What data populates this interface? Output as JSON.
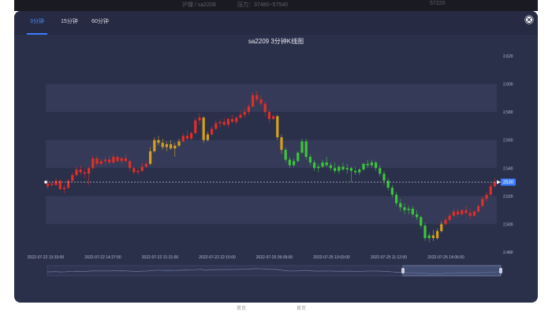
{
  "backdrop": {
    "top_items": [
      "沪镍 / sa2208",
      "压力：37480~57540",
      "57220"
    ],
    "bottom_items": [
      "首页",
      "首页"
    ]
  },
  "tabs": [
    {
      "label": "3分钟",
      "active": true
    },
    {
      "label": "15分钟",
      "active": false
    },
    {
      "label": "60分钟",
      "active": false
    }
  ],
  "close_icon": "close-circle-icon",
  "colors": {
    "background": "#2a2f4a",
    "band": "#343a57",
    "up": "#e02e28",
    "down": "#3ec43c",
    "flat": "#d4a020",
    "accent": "#3b7bff"
  },
  "chart_data": {
    "type": "candlestick",
    "title": "sa2209 3分钟K线图",
    "ylim": [
      2480,
      2620
    ],
    "yticks": [
      "2,620",
      "2,600",
      "2,580",
      "2,560",
      "2,540",
      "2,520",
      "2,500",
      "2,480"
    ],
    "xticks": [
      "2022-07-22 13:33:00",
      "2022-07-22 14:27:00",
      "2022-07-22 21:21:00",
      "2022-07-22 22:15:00",
      "2022-07-25 09:09:00",
      "2022-07-25 10:03:00",
      "2022-07-25 11:12:00",
      "2022-07-25 14:06:00"
    ],
    "current_price": 2530,
    "current_label": "2530",
    "grid": true,
    "bars": [
      {
        "o": 2527,
        "h": 2532,
        "l": 2525,
        "c": 2529,
        "color": "up"
      },
      {
        "o": 2529,
        "h": 2531,
        "l": 2527,
        "c": 2528,
        "color": "up"
      },
      {
        "o": 2528,
        "h": 2533,
        "l": 2527,
        "c": 2531,
        "color": "up"
      },
      {
        "o": 2531,
        "h": 2532,
        "l": 2524,
        "c": 2525,
        "color": "up"
      },
      {
        "o": 2525,
        "h": 2528,
        "l": 2522,
        "c": 2526,
        "color": "up"
      },
      {
        "o": 2526,
        "h": 2532,
        "l": 2525,
        "c": 2531,
        "color": "up"
      },
      {
        "o": 2531,
        "h": 2537,
        "l": 2530,
        "c": 2535,
        "color": "up"
      },
      {
        "o": 2535,
        "h": 2541,
        "l": 2534,
        "c": 2539,
        "color": "up"
      },
      {
        "o": 2539,
        "h": 2542,
        "l": 2535,
        "c": 2537,
        "color": "up"
      },
      {
        "o": 2537,
        "h": 2540,
        "l": 2533,
        "c": 2536,
        "color": "up"
      },
      {
        "o": 2536,
        "h": 2541,
        "l": 2528,
        "c": 2540,
        "color": "up"
      },
      {
        "o": 2540,
        "h": 2549,
        "l": 2539,
        "c": 2547,
        "color": "up"
      },
      {
        "o": 2547,
        "h": 2549,
        "l": 2541,
        "c": 2543,
        "color": "up"
      },
      {
        "o": 2543,
        "h": 2547,
        "l": 2541,
        "c": 2545,
        "color": "up"
      },
      {
        "o": 2545,
        "h": 2548,
        "l": 2542,
        "c": 2546,
        "color": "up"
      },
      {
        "o": 2546,
        "h": 2549,
        "l": 2543,
        "c": 2544,
        "color": "up"
      },
      {
        "o": 2544,
        "h": 2550,
        "l": 2543,
        "c": 2548,
        "color": "up"
      },
      {
        "o": 2548,
        "h": 2549,
        "l": 2544,
        "c": 2545,
        "color": "up"
      },
      {
        "o": 2545,
        "h": 2548,
        "l": 2543,
        "c": 2547,
        "color": "up"
      },
      {
        "o": 2547,
        "h": 2550,
        "l": 2544,
        "c": 2545,
        "color": "up"
      },
      {
        "o": 2545,
        "h": 2546,
        "l": 2538,
        "c": 2540,
        "color": "up"
      },
      {
        "o": 2540,
        "h": 2541,
        "l": 2535,
        "c": 2537,
        "color": "up"
      },
      {
        "o": 2537,
        "h": 2540,
        "l": 2535,
        "c": 2538,
        "color": "up"
      },
      {
        "o": 2538,
        "h": 2544,
        "l": 2537,
        "c": 2541,
        "color": "up"
      },
      {
        "o": 2541,
        "h": 2545,
        "l": 2540,
        "c": 2543,
        "color": "up"
      },
      {
        "o": 2543,
        "h": 2555,
        "l": 2542,
        "c": 2552,
        "color": "flat"
      },
      {
        "o": 2552,
        "h": 2562,
        "l": 2551,
        "c": 2560,
        "color": "flat"
      },
      {
        "o": 2560,
        "h": 2563,
        "l": 2556,
        "c": 2558,
        "color": "flat"
      },
      {
        "o": 2558,
        "h": 2561,
        "l": 2553,
        "c": 2555,
        "color": "flat"
      },
      {
        "o": 2555,
        "h": 2559,
        "l": 2552,
        "c": 2557,
        "color": "flat"
      },
      {
        "o": 2557,
        "h": 2560,
        "l": 2553,
        "c": 2554,
        "color": "flat"
      },
      {
        "o": 2554,
        "h": 2558,
        "l": 2548,
        "c": 2556,
        "color": "flat"
      },
      {
        "o": 2556,
        "h": 2561,
        "l": 2555,
        "c": 2559,
        "color": "flat"
      },
      {
        "o": 2559,
        "h": 2565,
        "l": 2558,
        "c": 2563,
        "color": "up"
      },
      {
        "o": 2563,
        "h": 2567,
        "l": 2560,
        "c": 2561,
        "color": "up"
      },
      {
        "o": 2561,
        "h": 2566,
        "l": 2560,
        "c": 2565,
        "color": "up"
      },
      {
        "o": 2565,
        "h": 2576,
        "l": 2564,
        "c": 2574,
        "color": "up"
      },
      {
        "o": 2574,
        "h": 2579,
        "l": 2571,
        "c": 2576,
        "color": "up"
      },
      {
        "o": 2576,
        "h": 2577,
        "l": 2558,
        "c": 2560,
        "color": "flat"
      },
      {
        "o": 2560,
        "h": 2566,
        "l": 2559,
        "c": 2564,
        "color": "flat"
      },
      {
        "o": 2564,
        "h": 2570,
        "l": 2563,
        "c": 2568,
        "color": "up"
      },
      {
        "o": 2568,
        "h": 2574,
        "l": 2567,
        "c": 2572,
        "color": "up"
      },
      {
        "o": 2572,
        "h": 2575,
        "l": 2569,
        "c": 2573,
        "color": "up"
      },
      {
        "o": 2573,
        "h": 2576,
        "l": 2570,
        "c": 2571,
        "color": "up"
      },
      {
        "o": 2571,
        "h": 2576,
        "l": 2569,
        "c": 2575,
        "color": "up"
      },
      {
        "o": 2575,
        "h": 2578,
        "l": 2572,
        "c": 2573,
        "color": "up"
      },
      {
        "o": 2573,
        "h": 2577,
        "l": 2571,
        "c": 2576,
        "color": "up"
      },
      {
        "o": 2576,
        "h": 2581,
        "l": 2575,
        "c": 2578,
        "color": "up"
      },
      {
        "o": 2578,
        "h": 2583,
        "l": 2576,
        "c": 2580,
        "color": "up"
      },
      {
        "o": 2580,
        "h": 2586,
        "l": 2578,
        "c": 2584,
        "color": "up"
      },
      {
        "o": 2584,
        "h": 2594,
        "l": 2583,
        "c": 2592,
        "color": "up"
      },
      {
        "o": 2592,
        "h": 2595,
        "l": 2587,
        "c": 2589,
        "color": "up"
      },
      {
        "o": 2589,
        "h": 2592,
        "l": 2584,
        "c": 2586,
        "color": "up"
      },
      {
        "o": 2586,
        "h": 2588,
        "l": 2577,
        "c": 2580,
        "color": "up"
      },
      {
        "o": 2580,
        "h": 2581,
        "l": 2572,
        "c": 2575,
        "color": "up"
      },
      {
        "o": 2575,
        "h": 2578,
        "l": 2574,
        "c": 2577,
        "color": "up"
      },
      {
        "o": 2577,
        "h": 2578,
        "l": 2560,
        "c": 2562,
        "color": "flat"
      },
      {
        "o": 2562,
        "h": 2564,
        "l": 2550,
        "c": 2553,
        "color": "flat"
      },
      {
        "o": 2553,
        "h": 2555,
        "l": 2544,
        "c": 2546,
        "color": "down"
      },
      {
        "o": 2546,
        "h": 2548,
        "l": 2540,
        "c": 2542,
        "color": "down"
      },
      {
        "o": 2542,
        "h": 2547,
        "l": 2541,
        "c": 2545,
        "color": "down"
      },
      {
        "o": 2545,
        "h": 2552,
        "l": 2544,
        "c": 2551,
        "color": "down"
      },
      {
        "o": 2551,
        "h": 2561,
        "l": 2550,
        "c": 2559,
        "color": "down"
      },
      {
        "o": 2559,
        "h": 2561,
        "l": 2546,
        "c": 2548,
        "color": "down"
      },
      {
        "o": 2548,
        "h": 2550,
        "l": 2542,
        "c": 2544,
        "color": "down"
      },
      {
        "o": 2544,
        "h": 2546,
        "l": 2538,
        "c": 2540,
        "color": "down"
      },
      {
        "o": 2540,
        "h": 2543,
        "l": 2537,
        "c": 2541,
        "color": "down"
      },
      {
        "o": 2541,
        "h": 2546,
        "l": 2540,
        "c": 2544,
        "color": "down"
      },
      {
        "o": 2544,
        "h": 2548,
        "l": 2541,
        "c": 2542,
        "color": "down"
      },
      {
        "o": 2542,
        "h": 2544,
        "l": 2538,
        "c": 2540,
        "color": "down"
      },
      {
        "o": 2540,
        "h": 2544,
        "l": 2536,
        "c": 2538,
        "color": "down"
      },
      {
        "o": 2538,
        "h": 2542,
        "l": 2536,
        "c": 2541,
        "color": "down"
      },
      {
        "o": 2541,
        "h": 2544,
        "l": 2538,
        "c": 2539,
        "color": "down"
      },
      {
        "o": 2539,
        "h": 2543,
        "l": 2536,
        "c": 2540,
        "color": "down"
      },
      {
        "o": 2540,
        "h": 2541,
        "l": 2530,
        "c": 2538,
        "color": "down"
      },
      {
        "o": 2538,
        "h": 2541,
        "l": 2535,
        "c": 2537,
        "color": "down"
      },
      {
        "o": 2537,
        "h": 2540,
        "l": 2535,
        "c": 2539,
        "color": "down"
      },
      {
        "o": 2539,
        "h": 2544,
        "l": 2538,
        "c": 2543,
        "color": "down"
      },
      {
        "o": 2543,
        "h": 2546,
        "l": 2540,
        "c": 2542,
        "color": "down"
      },
      {
        "o": 2542,
        "h": 2546,
        "l": 2540,
        "c": 2544,
        "color": "down"
      },
      {
        "o": 2544,
        "h": 2545,
        "l": 2538,
        "c": 2540,
        "color": "down"
      },
      {
        "o": 2540,
        "h": 2542,
        "l": 2534,
        "c": 2536,
        "color": "down"
      },
      {
        "o": 2536,
        "h": 2538,
        "l": 2528,
        "c": 2531,
        "color": "down"
      },
      {
        "o": 2531,
        "h": 2533,
        "l": 2524,
        "c": 2526,
        "color": "down"
      },
      {
        "o": 2526,
        "h": 2528,
        "l": 2519,
        "c": 2521,
        "color": "down"
      },
      {
        "o": 2521,
        "h": 2523,
        "l": 2513,
        "c": 2515,
        "color": "down"
      },
      {
        "o": 2515,
        "h": 2518,
        "l": 2509,
        "c": 2512,
        "color": "down"
      },
      {
        "o": 2512,
        "h": 2515,
        "l": 2507,
        "c": 2510,
        "color": "down"
      },
      {
        "o": 2510,
        "h": 2513,
        "l": 2507,
        "c": 2511,
        "color": "down"
      },
      {
        "o": 2511,
        "h": 2513,
        "l": 2505,
        "c": 2507,
        "color": "down"
      },
      {
        "o": 2507,
        "h": 2510,
        "l": 2503,
        "c": 2505,
        "color": "down"
      },
      {
        "o": 2505,
        "h": 2506,
        "l": 2497,
        "c": 2499,
        "color": "down"
      },
      {
        "o": 2499,
        "h": 2501,
        "l": 2488,
        "c": 2490,
        "color": "down"
      },
      {
        "o": 2490,
        "h": 2494,
        "l": 2487,
        "c": 2492,
        "color": "down"
      },
      {
        "o": 2492,
        "h": 2496,
        "l": 2488,
        "c": 2490,
        "color": "flat"
      },
      {
        "o": 2490,
        "h": 2497,
        "l": 2489,
        "c": 2495,
        "color": "flat"
      },
      {
        "o": 2495,
        "h": 2502,
        "l": 2494,
        "c": 2500,
        "color": "flat"
      },
      {
        "o": 2500,
        "h": 2505,
        "l": 2499,
        "c": 2503,
        "color": "up"
      },
      {
        "o": 2503,
        "h": 2508,
        "l": 2502,
        "c": 2506,
        "color": "up"
      },
      {
        "o": 2506,
        "h": 2511,
        "l": 2505,
        "c": 2509,
        "color": "up"
      },
      {
        "o": 2509,
        "h": 2511,
        "l": 2505,
        "c": 2507,
        "color": "up"
      },
      {
        "o": 2507,
        "h": 2511,
        "l": 2506,
        "c": 2510,
        "color": "up"
      },
      {
        "o": 2510,
        "h": 2513,
        "l": 2507,
        "c": 2508,
        "color": "up"
      },
      {
        "o": 2508,
        "h": 2511,
        "l": 2504,
        "c": 2506,
        "color": "up"
      },
      {
        "o": 2506,
        "h": 2510,
        "l": 2505,
        "c": 2509,
        "color": "up"
      },
      {
        "o": 2509,
        "h": 2514,
        "l": 2508,
        "c": 2513,
        "color": "up"
      },
      {
        "o": 2513,
        "h": 2520,
        "l": 2512,
        "c": 2518,
        "color": "up"
      },
      {
        "o": 2518,
        "h": 2523,
        "l": 2516,
        "c": 2521,
        "color": "up"
      },
      {
        "o": 2521,
        "h": 2529,
        "l": 2520,
        "c": 2527,
        "color": "up"
      },
      {
        "o": 2527,
        "h": 2533,
        "l": 2526,
        "c": 2530,
        "color": "up"
      }
    ]
  }
}
